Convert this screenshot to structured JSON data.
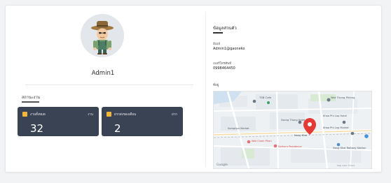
{
  "profile": {
    "name": "Admin1"
  },
  "stats": {
    "section_title": "สถานะงาน",
    "items": [
      {
        "label": "งานทั้งหมด",
        "unit": "งาน",
        "value": "32"
      },
      {
        "label": "ฝากส่งของเดือน",
        "unit": "ฝาก",
        "value": "2"
      }
    ]
  },
  "info": {
    "title": "ข้อมูลส่วนตัว",
    "email_label": "อีเมล์",
    "email_value": "Admin1@gaoneko",
    "phone_label": "เบอร์โทรศัพท์",
    "phone_value": "0998464450",
    "map_label": "ที่อยู่"
  },
  "map": {
    "place_labels": [
      "TSB Cafe",
      "Wat Thong Phleng",
      "Saeng Thong Hotel",
      "Khao Phi Lap Hotel",
      "Khao Phi Lap Market",
      "Nong Khai",
      "Somphon Market",
      "Wat Chom Phon",
      "Sathorn Residence",
      "Nong Khai Railway Station"
    ],
    "google_logo": "Google",
    "footer_text": "Map data ©2021"
  },
  "colors": {
    "stat_bg": "#3a4354",
    "stat_icon": "#f2b63b",
    "pin": "#e53935"
  }
}
